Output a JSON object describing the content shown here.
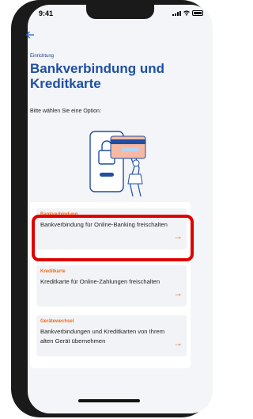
{
  "status_bar": {
    "time": "9:41"
  },
  "header": {
    "section_label": "Einrichtung",
    "title": "Bankverbindung und Kreditkarte"
  },
  "prompt": "Bitte wählen Sie eine Option:",
  "options": [
    {
      "tag": "Bankverbindung",
      "text": "Bankverbindung für Online-Banking freischalten",
      "highlighted": true
    },
    {
      "tag": "Kreditkarte",
      "text": "Kreditkarte für Online-Zahlungen freischalten",
      "highlighted": false
    },
    {
      "tag": "Gerätewechsel",
      "text": "Bankverbindungen und Kreditkarten von Ihrem alten Gerät übernehmen",
      "highlighted": false
    }
  ],
  "colors": {
    "accent": "#ef6b1b",
    "title": "#1f4fa3",
    "highlight": "#e00000"
  },
  "icons": {
    "back": "arrow-left-icon",
    "option_arrow": "arrow-right-icon",
    "illustration": "phone-lock-card-illustration"
  }
}
